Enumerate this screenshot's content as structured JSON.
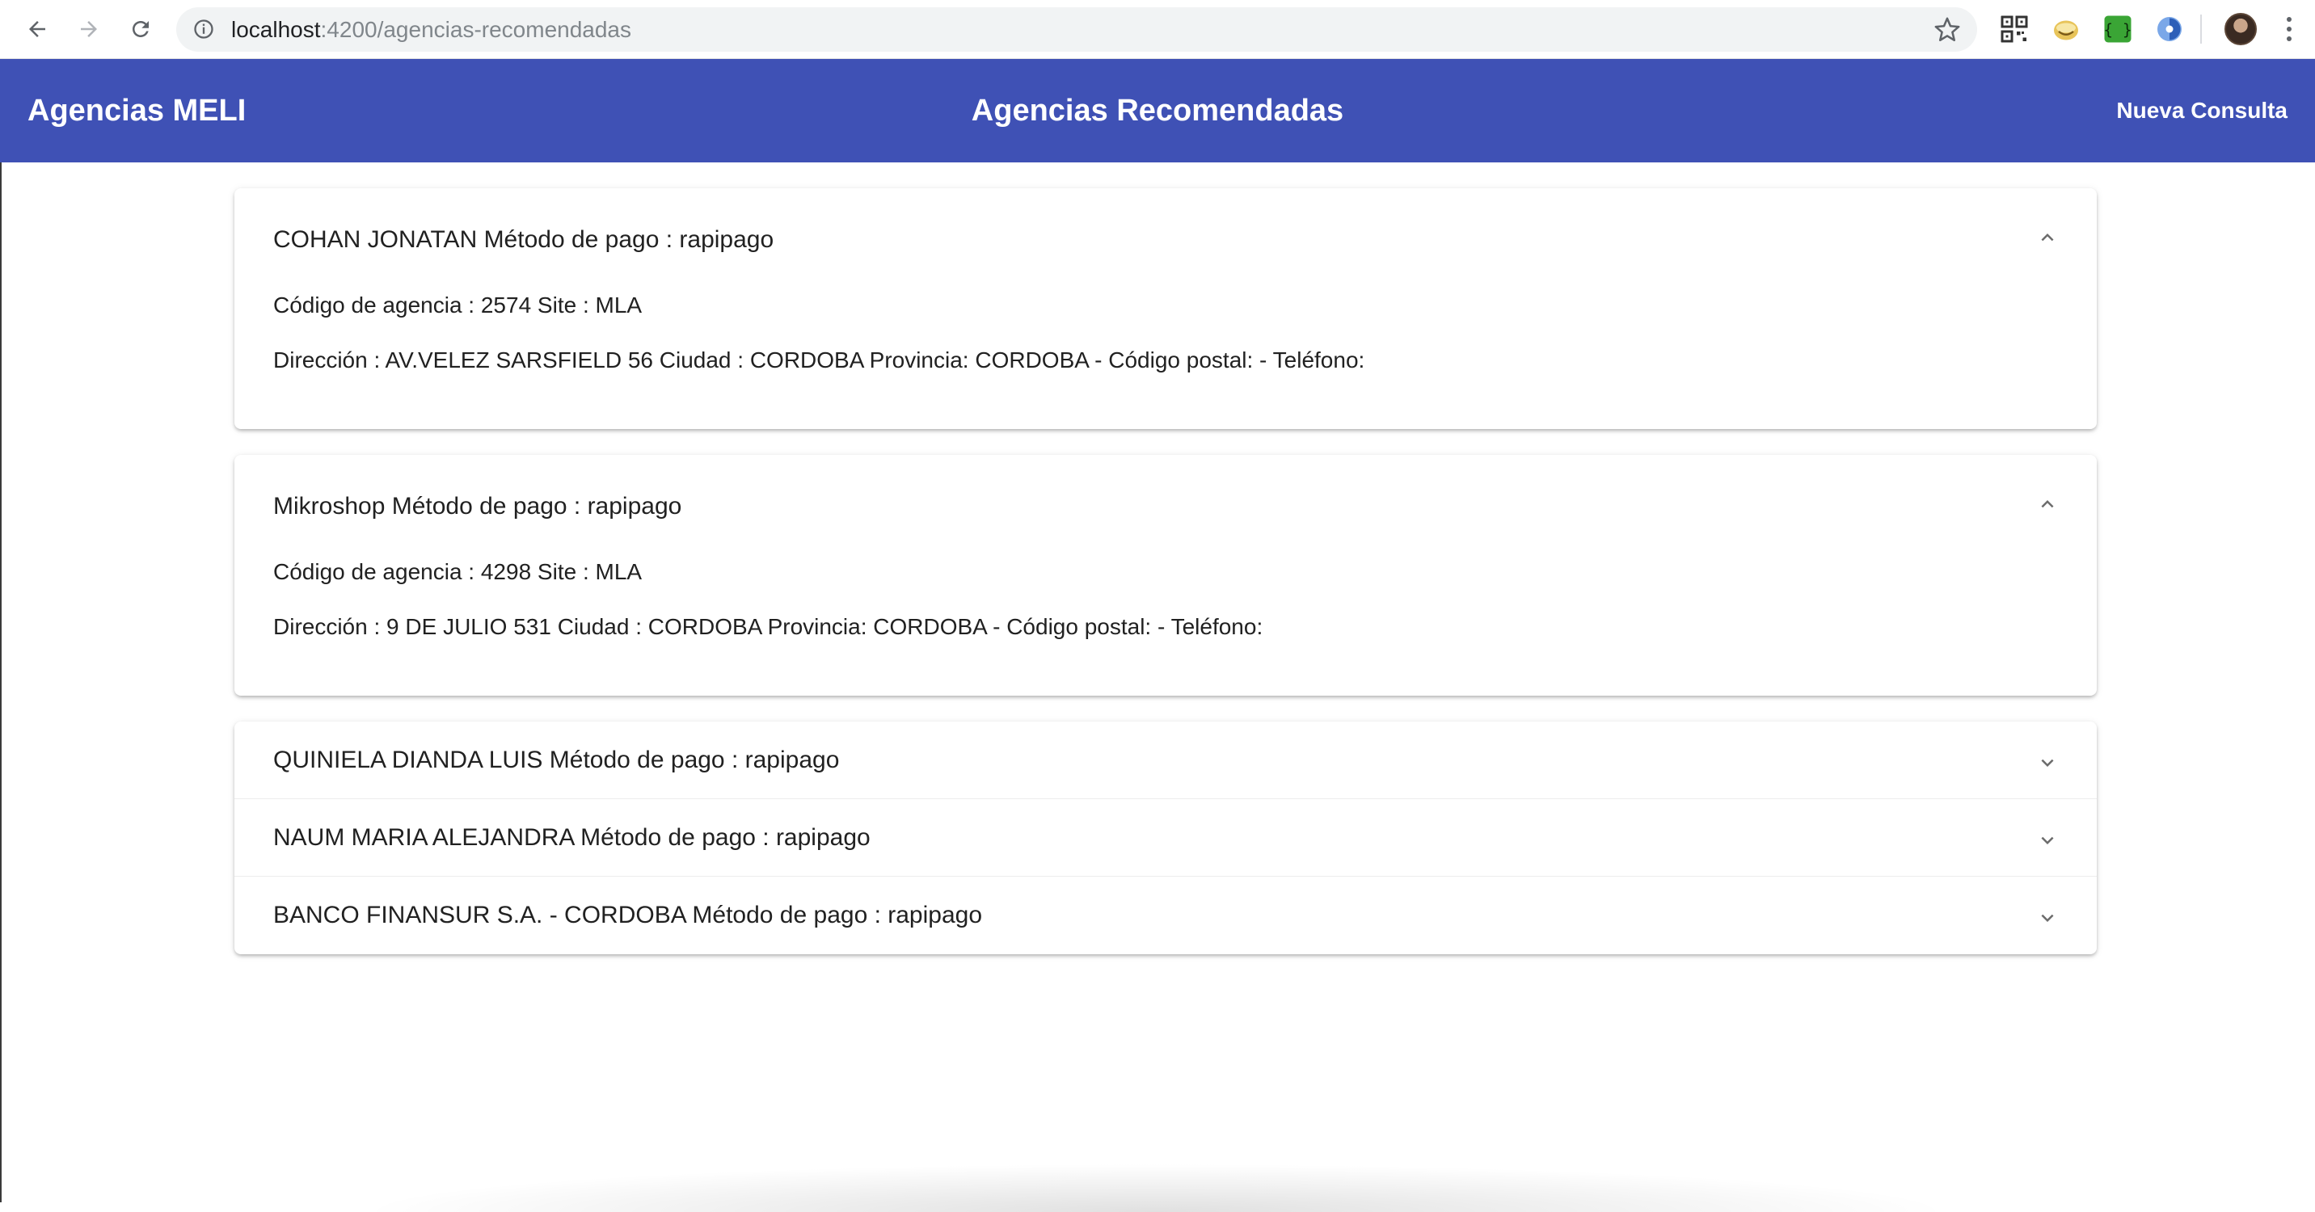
{
  "browser": {
    "url_host": "localhost",
    "url_rest": ":4200/agencias-recomendadas",
    "icons": [
      "back-icon",
      "forward-icon",
      "reload-icon",
      "info-icon",
      "star-icon",
      "qr-extension-icon",
      "smile-extension-icon",
      "braces-extension-icon",
      "blue-extension-icon",
      "avatar",
      "menu-icon"
    ]
  },
  "toolbar": {
    "app_title": "Agencias MELI",
    "page_title": "Agencias Recomendadas",
    "nueva_consulta": "Nueva Consulta",
    "color": "#3f51b5"
  },
  "agencies": [
    {
      "title": "COHAN JONATAN Método de pago : rapipago",
      "expanded": true,
      "codigo_line": "Código de agencia : 2574 Site : MLA",
      "direccion_line": "Dirección : AV.VELEZ SARSFIELD 56 Ciudad : CORDOBA Provincia: CORDOBA - Código postal: - Teléfono:"
    },
    {
      "title": "Mikroshop Método de pago : rapipago",
      "expanded": true,
      "codigo_line": "Código de agencia : 4298 Site : MLA",
      "direccion_line": "Dirección : 9 DE JULIO 531 Ciudad : CORDOBA Provincia: CORDOBA - Código postal: - Teléfono:"
    },
    {
      "title": "QUINIELA DIANDA LUIS Método de pago : rapipago",
      "expanded": false
    },
    {
      "title": "NAUM MARIA ALEJANDRA Método de pago : rapipago",
      "expanded": false
    },
    {
      "title": "BANCO FINANSUR S.A. - CORDOBA Método de pago : rapipago",
      "expanded": false
    }
  ]
}
